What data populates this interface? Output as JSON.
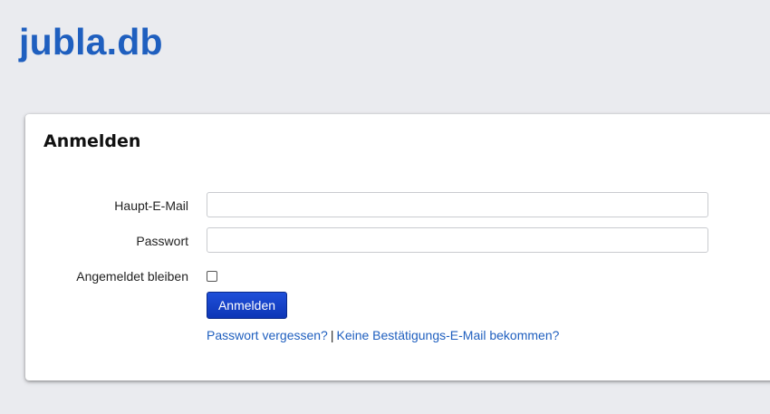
{
  "header": {
    "brand": "jubla.db"
  },
  "login": {
    "title": "Anmelden",
    "email_label": "Haupt-E-Mail",
    "email_value": "",
    "password_label": "Passwort",
    "password_value": "",
    "remember_label": "Angemeldet bleiben",
    "remember_checked": false,
    "submit_label": "Anmelden",
    "forgot_password_link": "Passwort vergessen?",
    "separator": "|",
    "no_confirmation_link": "Keine Bestätigungs-E-Mail bekommen?"
  }
}
